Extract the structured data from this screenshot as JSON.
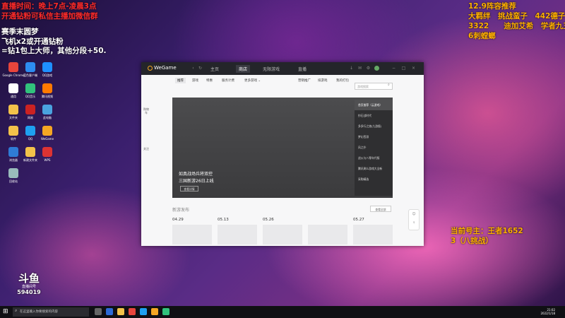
{
  "overlay": {
    "line1": "直播时间：晚上7点-凌晨3点",
    "line2": "开通钻粉可私信主播加微信群",
    "season_title": "赛季末圆梦",
    "season_line1": "飞机x2或开通钻粉",
    "season_line2": "=钻1包上大师，其他分段+50.",
    "rec_title": "12.9阵容推荐",
    "rec_line1": "大羁绊　挑战蛮子　442德子",
    "rec_line2": "3322　　迪加艾希　学者九五",
    "rec_line3": "6刺螳螂",
    "account_line1": "当前号主：王者1652",
    "account_line2": "3（八挑战）",
    "room_number": "594019",
    "wm_line1": "斗鱼",
    "wm_line2": "直播间号"
  },
  "desktop_icons": [
    {
      "label": "Google Chrome",
      "color": "#e8453c"
    },
    {
      "label": "蓝色客户端",
      "color": "#2d8cf0"
    },
    {
      "label": "QQ游戏",
      "color": "#1e90ff"
    },
    {
      "label": "通用",
      "color": "#ffffff"
    },
    {
      "label": "QQ音乐",
      "color": "#31c27c"
    },
    {
      "label": "腾讯视频",
      "color": "#ff7a00"
    },
    {
      "label": "文件夹",
      "color": "#f3c24a"
    },
    {
      "label": "网易",
      "color": "#cc2222"
    },
    {
      "label": "此电脑",
      "color": "#4aa3df"
    },
    {
      "label": "软件",
      "color": "#f3c24a"
    },
    {
      "label": "QQ",
      "color": "#1ea0f0"
    },
    {
      "label": "WeGame",
      "color": "#f5a623"
    },
    {
      "label": "浏览器",
      "color": "#2f7bd6"
    },
    {
      "label": "新建文件夹",
      "color": "#f3c24a"
    },
    {
      "label": "WPS",
      "color": "#d33"
    },
    {
      "label": "回收站",
      "color": "#9bb"
    }
  ],
  "wegame": {
    "title": "WeGame",
    "tabs": [
      "主页",
      "商店",
      "无限游戏",
      "直播"
    ],
    "window_controls": [
      "−",
      "□",
      "×"
    ],
    "subnav": [
      "推荐",
      "游戏",
      "特惠",
      "服务计费",
      "更多游戏 ⌄"
    ],
    "subnav_right": [
      "营销推广",
      "排游戏",
      "我的打包"
    ],
    "search_placeholder": "游戏搜索",
    "left_nav": [
      [
        "购物",
        "车"
      ],
      [
        "关注"
      ]
    ],
    "banner": {
      "title1": "如真战场兵将双控",
      "title2": "三国新游26日上线",
      "button": "查看详情"
    },
    "promo_list": [
      "首页推荐（云游戏）",
      "抄石战时代",
      "多多行之旅(九游版)",
      "梦幻西游",
      "风之扑",
      "战火与八零年代版",
      "腾讯刷么游戏大全新",
      "采购精选"
    ],
    "section_title": "新游发布",
    "more_button": "查看全部",
    "dates": [
      "04.29",
      "05.13",
      "05.26",
      "05.27"
    ]
  },
  "taskbar": {
    "search_placeholder": "在这里输入你要搜索的内容",
    "time": "21:02",
    "date": "2022/1/18"
  }
}
